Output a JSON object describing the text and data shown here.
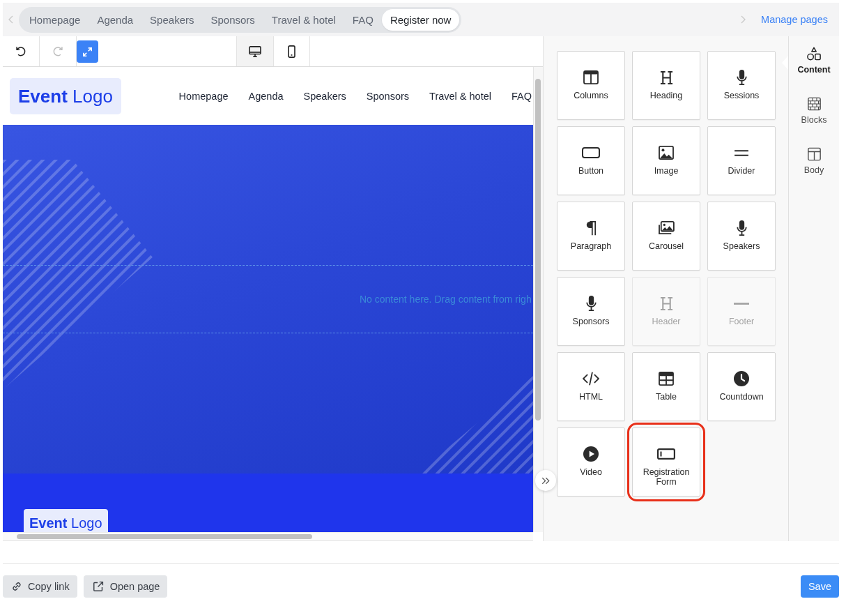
{
  "page_tabs": {
    "items": [
      {
        "label": "Homepage",
        "selected": false
      },
      {
        "label": "Agenda",
        "selected": false
      },
      {
        "label": "Speakers",
        "selected": false
      },
      {
        "label": "Sponsors",
        "selected": false
      },
      {
        "label": "Travel & hotel",
        "selected": false
      },
      {
        "label": "FAQ",
        "selected": false
      },
      {
        "label": "Register now",
        "selected": true
      }
    ],
    "manage_link": "Manage pages"
  },
  "toolbar": {
    "history": [
      {
        "kind": "undo",
        "disabled": false
      },
      {
        "kind": "redo",
        "disabled": true
      }
    ],
    "fullscreen": {
      "active": true
    },
    "devices": [
      {
        "kind": "desktop",
        "selected": true
      },
      {
        "kind": "mobile",
        "selected": false
      }
    ]
  },
  "preview": {
    "logo": "**Event** Logo",
    "nav": [
      "Homepage",
      "Agenda",
      "Speakers",
      "Sponsors",
      "Travel & hotel",
      "FAQ"
    ],
    "drop_hint": "No content here. Drag content from righ",
    "footer_logo": "**Event** Logo"
  },
  "content_panel": {
    "tiles": [
      {
        "label": "Columns",
        "kind": "columns",
        "disabled": false,
        "highlighted": false
      },
      {
        "label": "Heading",
        "kind": "heading",
        "disabled": false,
        "highlighted": false
      },
      {
        "label": "Sessions",
        "kind": "mic",
        "disabled": false,
        "highlighted": false
      },
      {
        "label": "Button",
        "kind": "button",
        "disabled": false,
        "highlighted": false
      },
      {
        "label": "Image",
        "kind": "image",
        "disabled": false,
        "highlighted": false
      },
      {
        "label": "Divider",
        "kind": "divider",
        "disabled": false,
        "highlighted": false
      },
      {
        "label": "Paragraph",
        "kind": "paragraph",
        "disabled": false,
        "highlighted": false
      },
      {
        "label": "Carousel",
        "kind": "carousel",
        "disabled": false,
        "highlighted": false
      },
      {
        "label": "Speakers",
        "kind": "mic",
        "disabled": false,
        "highlighted": false
      },
      {
        "label": "Sponsors",
        "kind": "mic",
        "disabled": false,
        "highlighted": false
      },
      {
        "label": "Header",
        "kind": "heading",
        "disabled": true,
        "highlighted": false
      },
      {
        "label": "Footer",
        "kind": "line",
        "disabled": true,
        "highlighted": false
      },
      {
        "label": "HTML",
        "kind": "code",
        "disabled": false,
        "highlighted": false
      },
      {
        "label": "Table",
        "kind": "table",
        "disabled": false,
        "highlighted": false
      },
      {
        "label": "Countdown",
        "kind": "clock",
        "disabled": false,
        "highlighted": false
      },
      {
        "label": "Video",
        "kind": "play",
        "disabled": false,
        "highlighted": false
      },
      {
        "label": "Registration Form",
        "kind": "form",
        "disabled": false,
        "highlighted": true
      }
    ]
  },
  "sidebar_tabs": [
    {
      "label": "Content",
      "kind": "shapes",
      "selected": true
    },
    {
      "label": "Blocks",
      "kind": "bricks",
      "selected": false
    },
    {
      "label": "Body",
      "kind": "layout",
      "selected": false
    }
  ],
  "footer": {
    "buttons": [
      {
        "kind": "copy-link",
        "label": "Copy link"
      },
      {
        "kind": "open-page",
        "label": "Open page"
      }
    ],
    "save": "Save"
  }
}
